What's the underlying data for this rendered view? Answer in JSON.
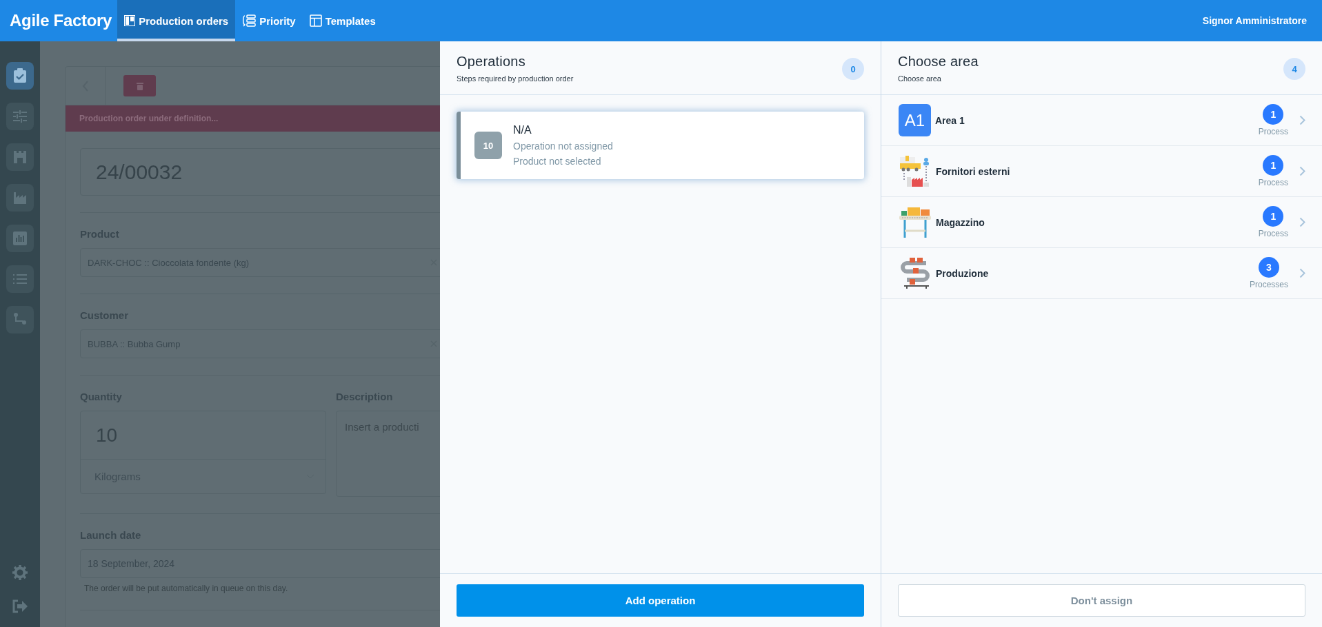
{
  "app": {
    "title": "Agile Factory",
    "user": "Signor Amministratore"
  },
  "nav_tabs": [
    {
      "label": "Production orders",
      "selected": true
    },
    {
      "label": "Priority",
      "selected": false
    },
    {
      "label": "Templates",
      "selected": false
    }
  ],
  "sidebar": {
    "items": [
      {
        "selected": true
      },
      {
        "selected": false
      },
      {
        "selected": false
      },
      {
        "selected": false
      },
      {
        "selected": false
      },
      {
        "selected": false
      },
      {
        "selected": false
      }
    ]
  },
  "order": {
    "banner": "Production order under definition...",
    "number": "24/00032",
    "product": {
      "label": "Product",
      "value": "DARK-CHOC :: Cioccolata fondente (kg)"
    },
    "customer": {
      "label": "Customer",
      "value": "BUBBA :: Bubba Gump"
    },
    "quantity": {
      "label": "Quantity",
      "value": "10",
      "unit": "Kilograms"
    },
    "description": {
      "label": "Description",
      "placeholder": "Insert a producti"
    },
    "launch_date": {
      "label": "Launch date",
      "value": "18 September, 2024",
      "hint": "The order will be put automatically in queue on this day."
    }
  },
  "operations": {
    "title": "Operations",
    "subtitle": "Steps required by production order",
    "count": "0",
    "items": [
      {
        "number": "10",
        "title": "N/A",
        "lines": [
          "Operation not assigned",
          "Product not selected"
        ]
      }
    ],
    "button": "Add operation"
  },
  "areas": {
    "title": "Choose area",
    "subtitle": "Choose area",
    "count": "4",
    "items": [
      {
        "kind": "monogram",
        "label": "A1",
        "name": "Area 1",
        "count": "1",
        "unit": "Process"
      },
      {
        "kind": "truck",
        "name": "Fornitori esterni",
        "count": "1",
        "unit": "Process"
      },
      {
        "kind": "shelf",
        "name": "Magazzino",
        "count": "1",
        "unit": "Process"
      },
      {
        "kind": "conveyor",
        "name": "Produzione",
        "count": "3",
        "unit": "Processes"
      }
    ],
    "button": "Don't assign"
  }
}
